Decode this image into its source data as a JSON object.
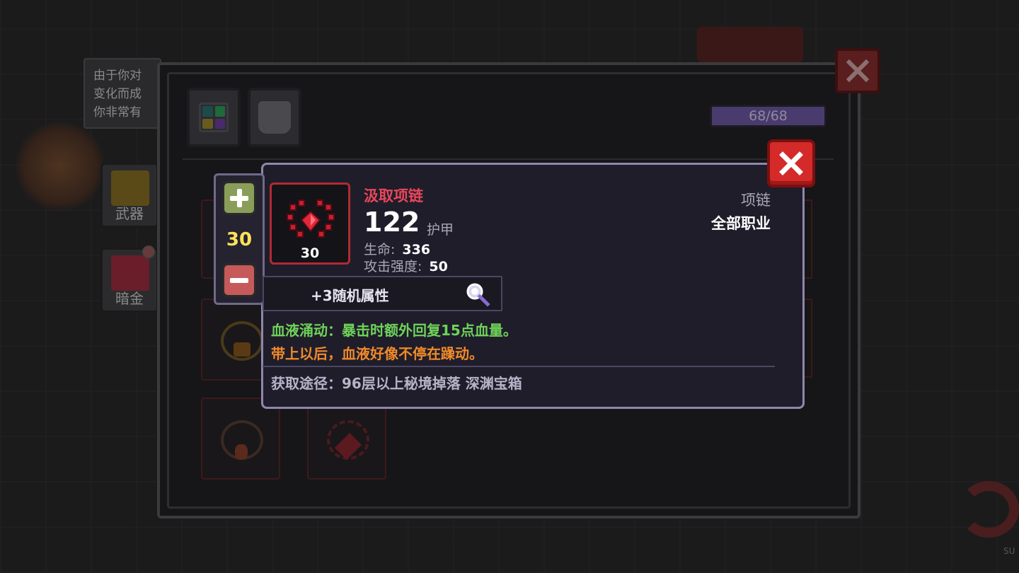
{
  "background": {
    "tooltip_lines": [
      "由于你对",
      "变化而成",
      "你非常有"
    ],
    "side_tabs": [
      {
        "label": "武器",
        "icon": "weapon-tab-icon"
      },
      {
        "label": "暗金",
        "icon": "dark-gold-tab-icon"
      }
    ],
    "corner_text": "SU"
  },
  "panel": {
    "categories": [
      {
        "icon": "all-items-grid-icon"
      },
      {
        "icon": "armor-helmet-icon"
      }
    ],
    "capacity": {
      "text": "68/68",
      "fraction": 1.0
    },
    "close_icon": "close-icon"
  },
  "stepper": {
    "value": "30",
    "plus_icon": "plus-icon",
    "minus_icon": "minus-icon"
  },
  "item": {
    "name": "汲取项链",
    "armor_value": "122",
    "armor_label": "护甲",
    "stats": [
      {
        "label": "生命:",
        "value": "336"
      },
      {
        "label": "攻击强度:",
        "value": "50"
      }
    ],
    "quantity": "30",
    "type": "项链",
    "class_restriction": "全部职业",
    "random_attributes": "+3随机属性",
    "effect_text": "血液涌动：暴击时额外回复15点血量。",
    "flavor_text": "带上以后，血液好像不停在躁动。",
    "source_text": "获取途径：96层以上秘境掉落 深渊宝箱",
    "icon": "blood-necklace-icon",
    "magnifier_icon": "magnifier-icon"
  },
  "colors": {
    "item_name": "#e8475a",
    "effect": "#6fd35a",
    "flavor": "#f08a2a",
    "stepper_value": "#ffe25a",
    "close_red": "#d42a2a"
  }
}
